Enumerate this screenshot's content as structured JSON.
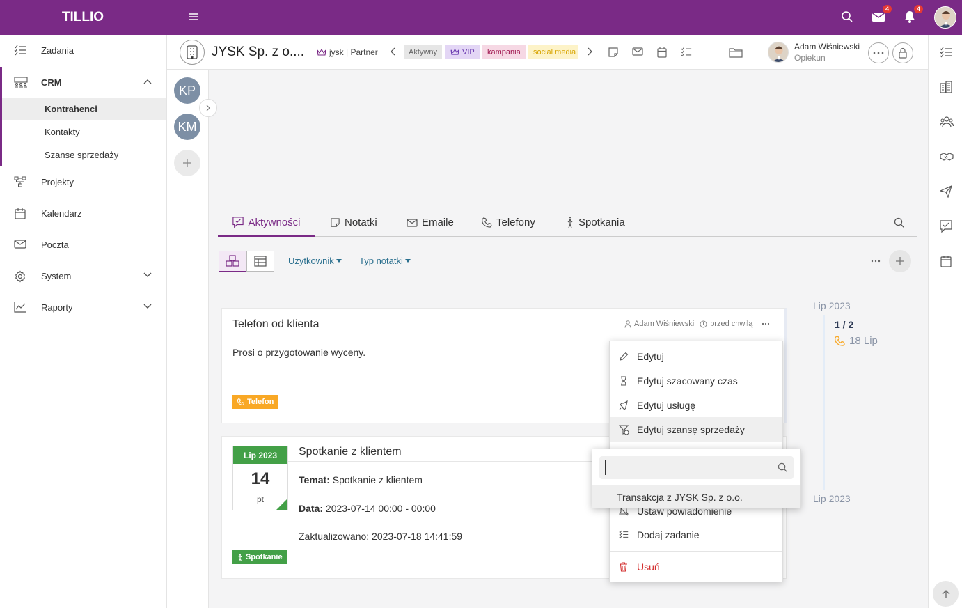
{
  "app": {
    "logo": "TILLIO",
    "mail_badge": "4",
    "notif_badge": "4"
  },
  "colors": {
    "brand": "#7a2a86",
    "phone_chip": "#f9a825",
    "meeting_chip": "#43a047",
    "link": "#2a6f8e",
    "danger": "#d32f2f"
  },
  "sidebar": {
    "tasks": "Zadania",
    "crm": "CRM",
    "crm_sub": [
      "Kontrahenci",
      "Kontakty",
      "Szanse sprzedaży"
    ],
    "projects": "Projekty",
    "calendar": "Kalendarz",
    "mail": "Poczta",
    "system": "System",
    "reports": "Raporty"
  },
  "header": {
    "company": "JYSK Sp. z o....",
    "partner": "jysk | Partner",
    "tags": [
      "Aktywny",
      "VIP",
      "kampania",
      "social media"
    ],
    "owner_name": "Adam Wiśniewski",
    "owner_role": "Opiekun"
  },
  "people": {
    "avatars": [
      "KP",
      "KM"
    ]
  },
  "tabs": {
    "activities": "Aktywności",
    "notes": "Notatki",
    "emails": "Emaile",
    "phones": "Telefony",
    "meetings": "Spotkania"
  },
  "filters": {
    "user": "Użytkownik",
    "note_type": "Typ notatki"
  },
  "card1": {
    "title": "Telefon od klienta",
    "author": "Adam Wiśniewski",
    "time": "przed chwilą",
    "body": "Prosi o przygotowanie wyceny.",
    "chip": "Telefon"
  },
  "card2": {
    "cal_month": "Lip 2023",
    "cal_day": "14",
    "cal_dow": "pt",
    "title": "Spotkanie z klientem",
    "topic_label": "Temat:",
    "topic": "Spotkanie z klientem",
    "date_label": "Data:",
    "date": "2023-07-14 00:00 - 00:00",
    "updated": "Zaktualizowano: 2023-07-18 14:41:59",
    "chip": "Spotkanie"
  },
  "timeline": {
    "month_top": "Lip 2023",
    "counter": "1 / 2",
    "entry": "18 Lip",
    "month_bottom": "Lip 2023"
  },
  "menu": {
    "edit": "Edytuj",
    "edit_time": "Edytuj szacowany czas",
    "edit_service": "Edytuj usługę",
    "edit_opportunity": "Edytuj szansę sprzedaży",
    "reminder": "Ustaw powiadomienie",
    "add_task": "Dodaj zadanie",
    "delete": "Usuń"
  },
  "submenu": {
    "search_value": "",
    "option": "Transakcja z JYSK Sp. z o.o."
  }
}
